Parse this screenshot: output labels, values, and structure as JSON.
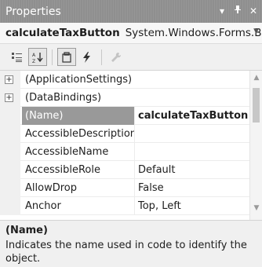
{
  "window": {
    "title": "Properties",
    "buttons": {
      "dropdown": "▾",
      "pin": "ꟷ",
      "close": "✕"
    }
  },
  "object_selector": {
    "name": "calculateTaxButton",
    "type": "System.Windows.Forms.B",
    "dropdown_icon": "chevron-down-icon"
  },
  "toolbar": {
    "buttons": [
      {
        "name": "categorized",
        "icon": "categorized-icon",
        "active": false
      },
      {
        "name": "alphabetical",
        "icon": "alphabetical-icon",
        "active": true
      },
      {
        "name": "properties",
        "icon": "properties-icon",
        "active": true
      },
      {
        "name": "events",
        "icon": "events-lightning-icon",
        "active": false
      },
      {
        "name": "property-pages",
        "icon": "wrench-icon",
        "active": false
      }
    ]
  },
  "properties": [
    {
      "name": "(ApplicationSettings)",
      "value": "",
      "expandable": true,
      "selected": false
    },
    {
      "name": "(DataBindings)",
      "value": "",
      "expandable": true,
      "selected": false
    },
    {
      "name": "(Name)",
      "value": "calculateTaxButton",
      "expandable": false,
      "selected": true
    },
    {
      "name": "AccessibleDescription",
      "value": "",
      "expandable": false,
      "selected": false
    },
    {
      "name": "AccessibleName",
      "value": "",
      "expandable": false,
      "selected": false
    },
    {
      "name": "AccessibleRole",
      "value": "Default",
      "expandable": false,
      "selected": false
    },
    {
      "name": "AllowDrop",
      "value": "False",
      "expandable": false,
      "selected": false
    },
    {
      "name": "Anchor",
      "value": "Top, Left",
      "expandable": false,
      "selected": false
    }
  ],
  "description": {
    "title": "(Name)",
    "text": "Indicates the name used in code to identify the object."
  },
  "colors": {
    "titlebar": "#8f8f8f",
    "selected_row": "#999999",
    "background": "#f0f0f0"
  }
}
